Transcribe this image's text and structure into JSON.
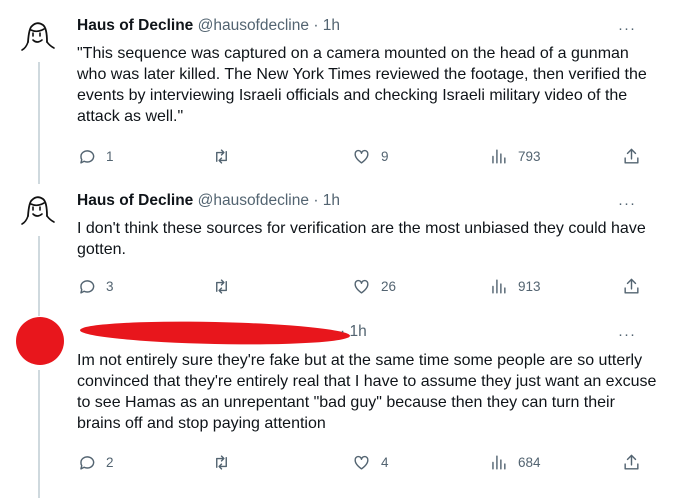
{
  "tweets": [
    {
      "name": "Haus of Decline",
      "handle": "@hausofdecline",
      "time": "· 1h",
      "text": "\"This sequence was captured on a camera mounted on the head of a gunman who was later killed. The New York Times reviewed the footage, then verified the events by interviewing Israeli officials and checking Israeli military video of the attack as well.\"",
      "replies": "1",
      "retweets": "",
      "likes": "9",
      "views": "793"
    },
    {
      "name": "Haus of Decline",
      "handle": "@hausofdecline",
      "time": "· 1h",
      "text": "I don't think these sources for verification are the most unbiased they could have gotten.",
      "replies": "3",
      "retweets": "",
      "likes": "26",
      "views": "913"
    },
    {
      "name": "",
      "handle": "",
      "time": "· 1h",
      "text": "Im not entirely sure they're fake but at the same time some people are so utterly convinced that they're entirely real that I have to assume they just want an excuse to see Hamas as an unrepentant \"bad guy\" because then they can turn their brains off and stop paying attention",
      "replies": "2",
      "retweets": "",
      "likes": "4",
      "views": "684"
    }
  ],
  "more_label": "···",
  "colors": {
    "text": "#0f1419",
    "secondary": "#536471",
    "thread_line": "#cfd9de",
    "redaction": "#e8161c"
  },
  "icons": [
    "avatar-drawing",
    "reply-icon",
    "retweet-icon",
    "like-icon",
    "views-icon",
    "share-icon",
    "more-icon"
  ]
}
